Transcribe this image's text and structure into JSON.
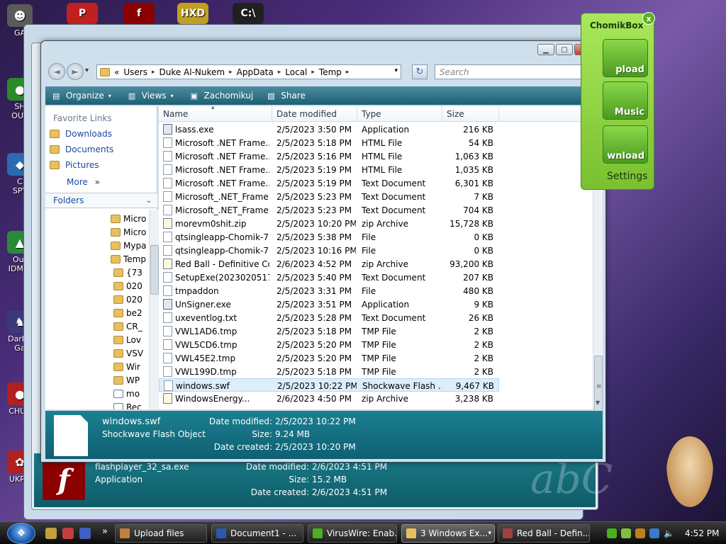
{
  "desktop": {
    "icons": [
      {
        "label": "GA",
        "color": "#5a5a5a",
        "glyph": "☻"
      },
      {
        "label": "SH\nOUT",
        "color": "#2a8a2a",
        "glyph": "●"
      },
      {
        "label": "C\nSPY",
        "color": "#2a6ab0",
        "glyph": "◆"
      },
      {
        "label": "Out\nIDM C",
        "color": "#2a8a3a",
        "glyph": "▲"
      },
      {
        "label": "DarkC\nGa",
        "color": "#3a3a7a",
        "glyph": "♞"
      },
      {
        "label": "CHUZ",
        "color": "#b02020",
        "glyph": "●"
      },
      {
        "label": "UKRA",
        "color": "#b02020",
        "glyph": "✿"
      }
    ],
    "top_icons": [
      {
        "glyph": "P",
        "color": "#c02020"
      },
      {
        "glyph": "f",
        "color": "#8b0000"
      },
      {
        "glyph": "HXD",
        "color": "#c0a020"
      },
      {
        "glyph": "C:\\",
        "color": "#202020"
      }
    ]
  },
  "bg_window": {
    "filename": "flashplayer_32_sa.exe",
    "type": "Application",
    "modified_label": "Date modified:",
    "modified": "2/6/2023 4:51 PM",
    "size_label": "Size:",
    "size": "15.2 MB",
    "created_label": "Date created:",
    "created": "2/6/2023 4:51 PM",
    "watermark": "abC",
    "flash_glyph": "f"
  },
  "window": {
    "controls": {
      "minimize": "▁",
      "maximize": "□",
      "close": "✕"
    },
    "nav": {
      "back": "◄",
      "forward": "►",
      "history": "▾"
    },
    "address": {
      "prefix": "«",
      "crumbs": [
        "Users",
        "Duke Al-Nukem",
        "AppData",
        "Local",
        "Temp"
      ],
      "sep": "▸",
      "dropdown": "▾"
    },
    "refresh": "↻",
    "search": {
      "placeholder": "Search",
      "icon": "⚲"
    },
    "commands": [
      {
        "label": "Organize",
        "icon": "▤",
        "arrow": "▾"
      },
      {
        "label": "Views",
        "icon": "▥",
        "arrow": "▾"
      },
      {
        "label": "Zachomikuj",
        "icon": "▣",
        "arrow": ""
      },
      {
        "label": "Share",
        "icon": "▧",
        "arrow": ""
      }
    ],
    "help": "?",
    "favorite_links": {
      "title": "Favorite Links",
      "items": [
        "Downloads",
        "Documents",
        "Pictures"
      ],
      "more": "More",
      "more_arrow": "»"
    },
    "folders": {
      "title": "Folders",
      "chevron": "⌄",
      "items": [
        {
          "label": "Micro",
          "indent": 0,
          "zip": false
        },
        {
          "label": "Micro",
          "indent": 0,
          "zip": false
        },
        {
          "label": "Mypa",
          "indent": 0,
          "zip": false
        },
        {
          "label": "Temp",
          "indent": 0,
          "zip": false
        },
        {
          "label": "{73",
          "indent": 1,
          "zip": false
        },
        {
          "label": "020",
          "indent": 1,
          "zip": false
        },
        {
          "label": "020",
          "indent": 1,
          "zip": false
        },
        {
          "label": "be2",
          "indent": 1,
          "zip": false
        },
        {
          "label": "CR_",
          "indent": 1,
          "zip": false
        },
        {
          "label": "Lov",
          "indent": 1,
          "zip": false
        },
        {
          "label": "VSV",
          "indent": 1,
          "zip": false
        },
        {
          "label": "Wir",
          "indent": 1,
          "zip": false
        },
        {
          "label": "WP",
          "indent": 1,
          "zip": false
        },
        {
          "label": "mo",
          "indent": 1,
          "zip": true
        },
        {
          "label": "Rec",
          "indent": 1,
          "zip": true
        }
      ]
    },
    "columns": [
      "Name",
      "Date modified",
      "Type",
      "Size"
    ],
    "sort_indicator": "▴",
    "files": [
      {
        "name": "lsass.exe",
        "date": "2/5/2023 3:50 PM",
        "type": "Application",
        "size": "216 KB",
        "icon": "app"
      },
      {
        "name": "Microsoft .NET Frame...",
        "date": "2/5/2023 5:18 PM",
        "type": "HTML File",
        "size": "54 KB",
        "icon": "doc"
      },
      {
        "name": "Microsoft .NET Frame...",
        "date": "2/5/2023 5:16 PM",
        "type": "HTML File",
        "size": "1,063 KB",
        "icon": "doc"
      },
      {
        "name": "Microsoft .NET Frame...",
        "date": "2/5/2023 5:19 PM",
        "type": "HTML File",
        "size": "1,035 KB",
        "icon": "doc"
      },
      {
        "name": "Microsoft .NET Frame...",
        "date": "2/5/2023 5:19 PM",
        "type": "Text Document",
        "size": "6,301 KB",
        "icon": "doc"
      },
      {
        "name": "Microsoft_.NET_Frame...",
        "date": "2/5/2023 5:23 PM",
        "type": "Text Document",
        "size": "7 KB",
        "icon": "doc"
      },
      {
        "name": "Microsoft_.NET_Frame...",
        "date": "2/5/2023 5:23 PM",
        "type": "Text Document",
        "size": "704 KB",
        "icon": "doc"
      },
      {
        "name": "morevm0shit.zip",
        "date": "2/5/2023 10:20 PM",
        "type": "zip Archive",
        "size": "15,728 KB",
        "icon": "zip"
      },
      {
        "name": "qtsingleapp-Chomik-7...",
        "date": "2/5/2023 5:38 PM",
        "type": "File",
        "size": "0 KB",
        "icon": "doc"
      },
      {
        "name": "qtsingleapp-Chomik-7...",
        "date": "2/5/2023 10:16 PM",
        "type": "File",
        "size": "0 KB",
        "icon": "doc"
      },
      {
        "name": "Red Ball - Definitive Co...",
        "date": "2/6/2023 4:52 PM",
        "type": "zip Archive",
        "size": "93,200 KB",
        "icon": "zip"
      },
      {
        "name": "SetupExe(20230205173...",
        "date": "2/5/2023 5:40 PM",
        "type": "Text Document",
        "size": "207 KB",
        "icon": "doc"
      },
      {
        "name": "tmpaddon",
        "date": "2/5/2023 3:31 PM",
        "type": "File",
        "size": "480 KB",
        "icon": "doc"
      },
      {
        "name": "UnSigner.exe",
        "date": "2/5/2023 3:51 PM",
        "type": "Application",
        "size": "9 KB",
        "icon": "app"
      },
      {
        "name": "uxeventlog.txt",
        "date": "2/5/2023 5:28 PM",
        "type": "Text Document",
        "size": "26 KB",
        "icon": "doc"
      },
      {
        "name": "VWL1AD6.tmp",
        "date": "2/5/2023 5:18 PM",
        "type": "TMP File",
        "size": "2 KB",
        "icon": "doc"
      },
      {
        "name": "VWL5CD6.tmp",
        "date": "2/5/2023 5:20 PM",
        "type": "TMP File",
        "size": "2 KB",
        "icon": "doc"
      },
      {
        "name": "VWL45E2.tmp",
        "date": "2/5/2023 5:20 PM",
        "type": "TMP File",
        "size": "2 KB",
        "icon": "doc"
      },
      {
        "name": "VWL199D.tmp",
        "date": "2/5/2023 5:18 PM",
        "type": "TMP File",
        "size": "2 KB",
        "icon": "doc"
      },
      {
        "name": "windows.swf",
        "date": "2/5/2023 10:22 PM",
        "type": "Shockwave Flash ...",
        "size": "9,467 KB",
        "icon": "doc"
      },
      {
        "name": "WindowsEnergy...",
        "date": "2/6/2023 4:50 PM",
        "type": "zip Archive",
        "size": "3,238 KB",
        "icon": "zip"
      }
    ],
    "selected_index": 19,
    "scroll": {
      "up": "▲",
      "down": "▼",
      "grip": "≡"
    },
    "details": {
      "filename": "windows.swf",
      "type": "Shockwave Flash Object",
      "modified_label": "Date modified:",
      "modified": "2/5/2023 10:22 PM",
      "size_label": "Size:",
      "size": "9.24 MB",
      "created_label": "Date created:",
      "created": "2/5/2023 10:20 PM"
    }
  },
  "chomikbox": {
    "title": "ChomikBox",
    "close": "x",
    "buttons": [
      "pload",
      "Music",
      "wnload"
    ],
    "settings": "Settings"
  },
  "taskbar": {
    "start_glyph": "❖",
    "more": "»",
    "tasks": [
      {
        "label": "Upload files",
        "color": "#c08040",
        "active": false
      },
      {
        "label": "Document1 - ...",
        "color": "#2a5ab0",
        "active": false
      },
      {
        "label": "VirusWire: Enab...",
        "color": "#4ab020",
        "active": false
      },
      {
        "label": "3 Windows Ex...",
        "color": "#e8c060",
        "active": true,
        "arrow": "▾"
      },
      {
        "label": "Red Ball - Defin...",
        "color": "#a04040",
        "active": false
      }
    ],
    "clock": "4:52 PM",
    "tray_glyph_volume": "🔈"
  },
  "colors": {
    "accent": "#1e5f75",
    "selection": "#ddeefb",
    "link": "#1a4a9a",
    "chomik_green": "#7ac030"
  }
}
